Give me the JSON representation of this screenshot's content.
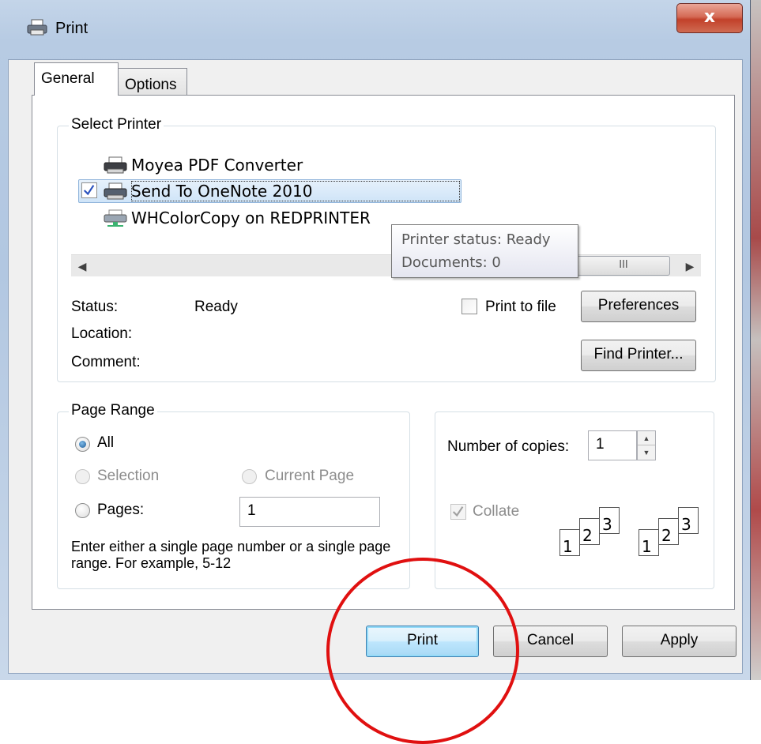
{
  "window": {
    "title": "Print",
    "close_glyph": "x"
  },
  "tabs": [
    {
      "label": "General",
      "active": true
    },
    {
      "label": "Options",
      "active": false
    }
  ],
  "select_printer": {
    "group_label": "Select Printer",
    "printers": [
      {
        "name": "Moyea PDF Converter",
        "icon": "printer-icon",
        "selected": false
      },
      {
        "name": "Send To OneNote 2010",
        "icon": "printer-icon",
        "selected": true
      },
      {
        "name": "WHColorCopy on REDPRINTER",
        "icon": "network-printer-icon",
        "selected": false
      }
    ],
    "scrollbar_thumb_glyph": "III",
    "tooltip": {
      "line1": "Printer status: Ready",
      "line2": "Documents: 0"
    },
    "status_label": "Status:",
    "status_value": "Ready",
    "location_label": "Location:",
    "comment_label": "Comment:",
    "print_to_file_label": "Print to file",
    "preferences_button": "Preferences",
    "find_printer_button": "Find Printer..."
  },
  "page_range": {
    "group_label": "Page Range",
    "all_label": "All",
    "selection_label": "Selection",
    "current_page_label": "Current Page",
    "pages_label": "Pages:",
    "pages_value": "1",
    "hint": "Enter either a single page number or a single page range.  For example, 5-12",
    "selected": "All"
  },
  "copies": {
    "number_label": "Number of copies:",
    "number_value": "1",
    "collate_label": "Collate",
    "collate_checked": true,
    "collate_pages": [
      "1",
      "2",
      "3"
    ]
  },
  "footer": {
    "print_button": "Print",
    "cancel_button": "Cancel",
    "apply_button": "Apply"
  },
  "colors": {
    "annotation_circle": "#e01010",
    "close_button": "#c2412a",
    "selection_highlight": "#cfe4f8"
  }
}
